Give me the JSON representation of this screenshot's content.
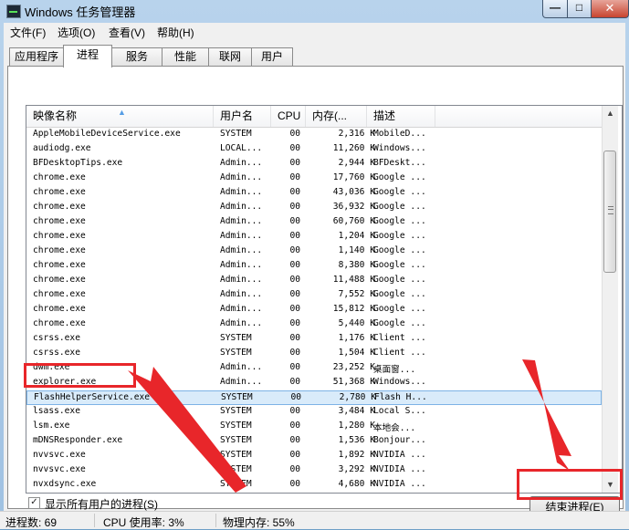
{
  "window": {
    "title": "Windows 任务管理器",
    "min": "—",
    "max": "□",
    "close": "✕"
  },
  "menu": [
    "文件(F)",
    "选项(O)",
    "查看(V)",
    "帮助(H)"
  ],
  "tabs": [
    "应用程序",
    "进程",
    "服务",
    "性能",
    "联网",
    "用户"
  ],
  "active_tab": "进程",
  "columns": [
    "映像名称",
    "用户名",
    "CPU",
    "内存(...",
    "描述"
  ],
  "processes": [
    {
      "name": "AppleMobileDeviceService.exe",
      "user": "SYSTEM",
      "cpu": "00",
      "mem": "2,316 K",
      "desc": "MobileD..."
    },
    {
      "name": "audiodg.exe",
      "user": "LOCAL...",
      "cpu": "00",
      "mem": "11,260 K",
      "desc": "Windows..."
    },
    {
      "name": "BFDesktopTips.exe",
      "user": "Admin...",
      "cpu": "00",
      "mem": "2,944 K",
      "desc": "BFDeskt..."
    },
    {
      "name": "chrome.exe",
      "user": "Admin...",
      "cpu": "00",
      "mem": "17,760 K",
      "desc": "Google ..."
    },
    {
      "name": "chrome.exe",
      "user": "Admin...",
      "cpu": "00",
      "mem": "43,036 K",
      "desc": "Google ..."
    },
    {
      "name": "chrome.exe",
      "user": "Admin...",
      "cpu": "00",
      "mem": "36,932 K",
      "desc": "Google ..."
    },
    {
      "name": "chrome.exe",
      "user": "Admin...",
      "cpu": "00",
      "mem": "60,760 K",
      "desc": "Google ..."
    },
    {
      "name": "chrome.exe",
      "user": "Admin...",
      "cpu": "00",
      "mem": "1,204 K",
      "desc": "Google ..."
    },
    {
      "name": "chrome.exe",
      "user": "Admin...",
      "cpu": "00",
      "mem": "1,140 K",
      "desc": "Google ..."
    },
    {
      "name": "chrome.exe",
      "user": "Admin...",
      "cpu": "00",
      "mem": "8,380 K",
      "desc": "Google ..."
    },
    {
      "name": "chrome.exe",
      "user": "Admin...",
      "cpu": "00",
      "mem": "11,488 K",
      "desc": "Google ..."
    },
    {
      "name": "chrome.exe",
      "user": "Admin...",
      "cpu": "00",
      "mem": "7,552 K",
      "desc": "Google ..."
    },
    {
      "name": "chrome.exe",
      "user": "Admin...",
      "cpu": "00",
      "mem": "15,812 K",
      "desc": "Google ..."
    },
    {
      "name": "chrome.exe",
      "user": "Admin...",
      "cpu": "00",
      "mem": "5,440 K",
      "desc": "Google ..."
    },
    {
      "name": "csrss.exe",
      "user": "SYSTEM",
      "cpu": "00",
      "mem": "1,176 K",
      "desc": "Client ..."
    },
    {
      "name": "csrss.exe",
      "user": "SYSTEM",
      "cpu": "00",
      "mem": "1,504 K",
      "desc": "Client ..."
    },
    {
      "name": "dwm.exe",
      "user": "Admin...",
      "cpu": "00",
      "mem": "23,252 K",
      "desc": "桌面窗..."
    },
    {
      "name": "explorer.exe",
      "user": "Admin...",
      "cpu": "00",
      "mem": "51,368 K",
      "desc": "Windows..."
    },
    {
      "name": "FlashHelperService.exe",
      "user": "SYSTEM",
      "cpu": "00",
      "mem": "2,780 K",
      "desc": "Flash H..."
    },
    {
      "name": "lsass.exe",
      "user": "SYSTEM",
      "cpu": "00",
      "mem": "3,484 K",
      "desc": "Local S..."
    },
    {
      "name": "lsm.exe",
      "user": "SYSTEM",
      "cpu": "00",
      "mem": "1,280 K",
      "desc": "本地会..."
    },
    {
      "name": "mDNSResponder.exe",
      "user": "SYSTEM",
      "cpu": "00",
      "mem": "1,536 K",
      "desc": "Bonjour..."
    },
    {
      "name": "nvvsvc.exe",
      "user": "SYSTEM",
      "cpu": "00",
      "mem": "1,892 K",
      "desc": "NVIDIA ..."
    },
    {
      "name": "nvvsvc.exe",
      "user": "SYSTEM",
      "cpu": "00",
      "mem": "3,292 K",
      "desc": "NVIDIA ..."
    },
    {
      "name": "nvxdsync.exe",
      "user": "SYSTEM",
      "cpu": "00",
      "mem": "4,680 K",
      "desc": "NVIDIA ..."
    }
  ],
  "selected_row": "FlashHelperService.exe",
  "show_all_users": {
    "checked": true,
    "label": "显示所有用户的进程(S)"
  },
  "end_process_button": "结束进程(E)",
  "status": {
    "processes": "进程数: 69",
    "cpu": "CPU 使用率: 3%",
    "memory": "物理内存: 55%"
  },
  "annotation_color": "#e8262a"
}
